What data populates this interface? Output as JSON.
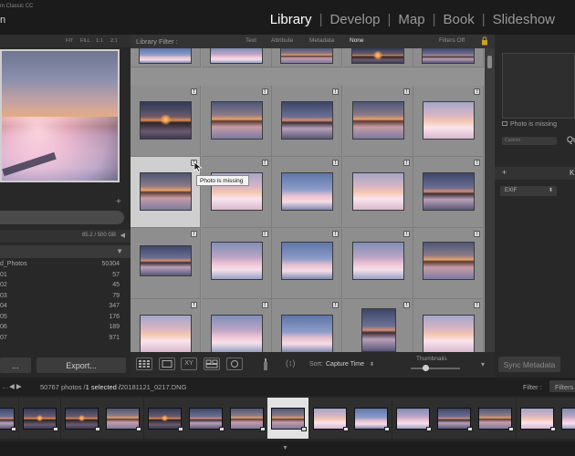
{
  "app": {
    "name": "Adobe Photoshop Lightroom Classic CC",
    "name_visible": "m Classic CC",
    "sub_visible": "n"
  },
  "modules": [
    {
      "label": "Library",
      "active": true
    },
    {
      "label": "Develop",
      "active": false
    },
    {
      "label": "Map",
      "active": false
    },
    {
      "label": "Book",
      "active": false
    },
    {
      "label": "Slideshow",
      "active": false
    }
  ],
  "navigator": {
    "zoom_options": [
      "FIT",
      "FILL",
      "1:1",
      "2:1"
    ]
  },
  "left_panel": {
    "volume_size": "85.2 / 500 GB",
    "folders": [
      {
        "name": "d_Photos",
        "count": "50304"
      },
      {
        "name": "01",
        "count": "57"
      },
      {
        "name": "02",
        "count": "45"
      },
      {
        "name": "03",
        "count": "79"
      },
      {
        "name": "04",
        "count": "347"
      },
      {
        "name": "05",
        "count": "176"
      },
      {
        "name": "06",
        "count": "189"
      },
      {
        "name": "07",
        "count": "971"
      }
    ],
    "export_label": "Export..."
  },
  "filter_bar": {
    "label": "Library Filter :",
    "tabs": [
      "Text",
      "Attribute",
      "Metadata",
      "None"
    ],
    "active_tab": "None",
    "filters_off": "Filters Off"
  },
  "grid": {
    "tooltip": "Photo is missing",
    "missing_badge": "!"
  },
  "toolbar": {
    "sort_label": "Sort:",
    "sort_value": "Capture Time",
    "thumbnails_label": "Thumbnails",
    "thumbnail_size": 0.3
  },
  "right_panel": {
    "histogram_note": "Photo is missing",
    "quick_develop_label": "Qu",
    "quick_develop_preset": "Custom",
    "keywording_label": "K",
    "metadata_preset": "EXIF",
    "sync_label": "Sync Metadata"
  },
  "filmstrip_bar": {
    "info_prefix": "50767 photos /",
    "info_selected": "1 selected /",
    "info_file": "20181121_0217.DNG",
    "filter_label": "Filter :",
    "filters_btn": "Filters"
  },
  "colors": {
    "active_module": "#ffffff",
    "grid_bg": "#929292",
    "selected_cell": "#cfcfcf"
  }
}
